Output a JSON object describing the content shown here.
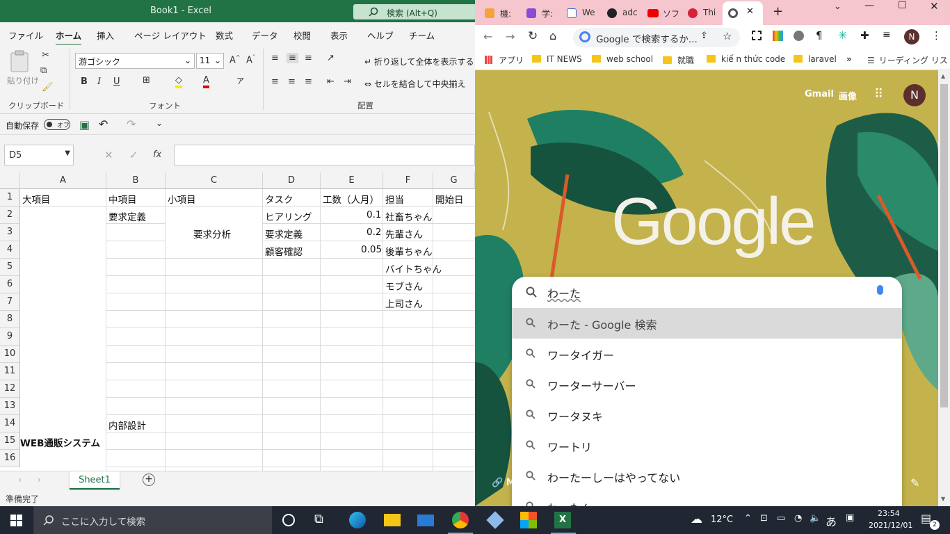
{
  "excel": {
    "title": "Book1 - Excel",
    "search_placeholder": "検索 (Alt+Q)",
    "ribbon_tabs": [
      "ファイル",
      "ホーム",
      "挿入",
      "ページ レイアウト",
      "数式",
      "データ",
      "校閲",
      "表示",
      "ヘルプ",
      "チーム"
    ],
    "paste_label": "貼り付け",
    "font_name": "游ゴシック",
    "font_size": "11",
    "wrap_text": "折り返して全体を表示する",
    "merge_center": "セルを結合して中央揃え",
    "groups": {
      "clipboard": "クリップボード",
      "font": "フォント",
      "alignment": "配置"
    },
    "autosave_label": "自動保存",
    "autosave_state": "オフ",
    "name_box": "D5",
    "fx": "fx",
    "columns": [
      "A",
      "B",
      "C",
      "D",
      "E",
      "F",
      "G"
    ],
    "rows": [
      "1",
      "2",
      "3",
      "4",
      "5",
      "6",
      "7",
      "8",
      "9",
      "10",
      "11",
      "12",
      "13",
      "14",
      "15",
      "16"
    ],
    "cells": {
      "A1": "大項目",
      "B1": "中項目",
      "C1": "小項目",
      "D1": "タスク",
      "E1": "工数（人月）",
      "F1": "担当",
      "G1": "開始日",
      "B2": "要求定義",
      "C3": "要求分析",
      "D2": "ヒアリング",
      "D3": "要求定義",
      "D4": "顧客確認",
      "E2": "0.1",
      "E3": "0.2",
      "E4": "0.05",
      "F2": "社畜ちゃん",
      "F3": "先輩さん",
      "F4": "後輩ちゃん",
      "F5": "バイトちゃん",
      "F6": "モブさん",
      "F7": "上司さん",
      "B14": "内部設計",
      "A15": "WEB通販システム"
    },
    "sheet_tab": "Sheet1",
    "status": "準備完了"
  },
  "chrome": {
    "tabs": [
      "機:",
      "学:",
      "We",
      "adc",
      "ソフ",
      "Thi"
    ],
    "omnibox_text": "Google で検索するか...",
    "profile_initial": "N",
    "bookmarks": [
      "アプリ",
      "IT NEWS",
      "web school",
      "就職",
      "kiế n thức code",
      "laravel"
    ],
    "reading_list": "リーディング リスト",
    "top_links": [
      "Gmail",
      "画像"
    ],
    "logo": "Google",
    "search_query": "わーた",
    "suggestions": [
      "わーた - Google 検索",
      "ワータイガー",
      "ワーターサーバー",
      "ワータヌキ",
      "ワートリ",
      "わーたーしーはやってない",
      "わーたん"
    ],
    "shortcut_partial": "M",
    "accent_color": "#c4b24c"
  },
  "taskbar": {
    "search_placeholder": "ここに入力して検索",
    "weather": "12°C",
    "ime": "あ",
    "time": "23:54",
    "date": "2021/12/01",
    "notifications": "2"
  }
}
